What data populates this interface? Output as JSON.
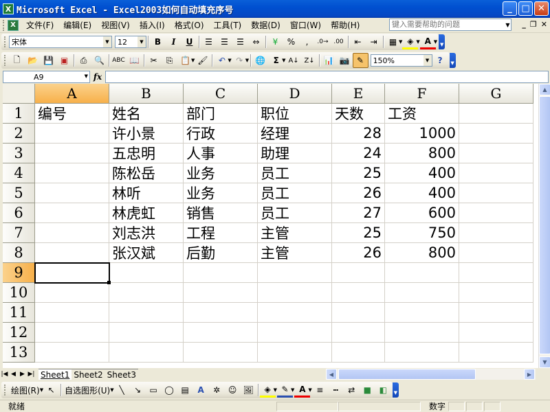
{
  "window": {
    "title": "Microsoft Excel - Excel2003如何自动填充序号",
    "app_icon": "X"
  },
  "menu": {
    "items": [
      "文件(F)",
      "编辑(E)",
      "视图(V)",
      "插入(I)",
      "格式(O)",
      "工具(T)",
      "数据(D)",
      "窗口(W)",
      "帮助(H)"
    ],
    "help_placeholder": "键入需要帮助的问题"
  },
  "format_toolbar": {
    "font_name": "宋体",
    "font_size": "12",
    "bold": "B",
    "italic": "I",
    "underline": "U",
    "percent": "%",
    "comma": ",",
    "currency": "¥",
    "font_color_label": "A"
  },
  "standard_toolbar": {
    "zoom": "150%",
    "sum": "Σ"
  },
  "formula_bar": {
    "name_box": "A9",
    "fx": "fx",
    "formula": ""
  },
  "grid": {
    "columns": [
      "A",
      "B",
      "C",
      "D",
      "E",
      "F",
      "G"
    ],
    "active_column": "A",
    "active_row": 9,
    "rows": [
      [
        "编号",
        "姓名",
        "部门",
        "职位",
        "天数",
        "工资",
        ""
      ],
      [
        "",
        "许小景",
        "行政",
        "经理",
        "28",
        "1000",
        ""
      ],
      [
        "",
        "五忠明",
        "人事",
        "助理",
        "24",
        "800",
        ""
      ],
      [
        "",
        "陈松岳",
        "业务",
        "员工",
        "25",
        "400",
        ""
      ],
      [
        "",
        "林听",
        "业务",
        "员工",
        "26",
        "400",
        ""
      ],
      [
        "",
        "林虎虹",
        "销售",
        "员工",
        "27",
        "600",
        ""
      ],
      [
        "",
        "刘志洪",
        "工程",
        "主管",
        "25",
        "750",
        ""
      ],
      [
        "",
        "张汉斌",
        "后勤",
        "主管",
        "26",
        "800",
        ""
      ],
      [
        "",
        "",
        "",
        "",
        "",
        "",
        ""
      ],
      [
        "",
        "",
        "",
        "",
        "",
        "",
        ""
      ],
      [
        "",
        "",
        "",
        "",
        "",
        "",
        ""
      ],
      [
        "",
        "",
        "",
        "",
        "",
        "",
        ""
      ],
      [
        "",
        "",
        "",
        "",
        "",
        "",
        ""
      ]
    ]
  },
  "sheets": {
    "tabs": [
      "Sheet1",
      "Sheet2",
      "Sheet3"
    ],
    "active": "Sheet1"
  },
  "drawing_toolbar": {
    "draw_label": "绘图(R)",
    "autoshapes_label": "自选图形(U)"
  },
  "status": {
    "ready": "就绪",
    "num": "数字"
  },
  "colors": {
    "title_bar": "#0054e3",
    "active_header": "#f7b04a",
    "grid_line": "#d4d0c8",
    "toolbar_bg": "#ece9d8"
  }
}
